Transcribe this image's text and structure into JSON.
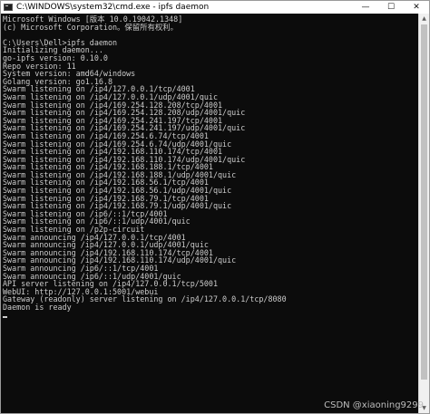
{
  "window": {
    "title": "C:\\WINDOWS\\system32\\cmd.exe - ipfs  daemon",
    "controls": {
      "minimize": "—",
      "maximize": "☐",
      "close": "✕"
    }
  },
  "console": {
    "lines": [
      "Microsoft Windows [版本 10.0.19042.1348]",
      "(c) Microsoft Corporation。保留所有权利。",
      "",
      "C:\\Users\\Dell>ipfs daemon",
      "Initializing daemon...",
      "go-ipfs version: 0.10.0",
      "Repo version: 11",
      "System version: amd64/windows",
      "Golang version: go1.16.8",
      "Swarm listening on /ip4/127.0.0.1/tcp/4001",
      "Swarm listening on /ip4/127.0.0.1/udp/4001/quic",
      "Swarm listening on /ip4/169.254.128.208/tcp/4001",
      "Swarm listening on /ip4/169.254.128.208/udp/4001/quic",
      "Swarm listening on /ip4/169.254.241.197/tcp/4001",
      "Swarm listening on /ip4/169.254.241.197/udp/4001/quic",
      "Swarm listening on /ip4/169.254.6.74/tcp/4001",
      "Swarm listening on /ip4/169.254.6.74/udp/4001/quic",
      "Swarm listening on /ip4/192.168.110.174/tcp/4001",
      "Swarm listening on /ip4/192.168.110.174/udp/4001/quic",
      "Swarm listening on /ip4/192.168.188.1/tcp/4001",
      "Swarm listening on /ip4/192.168.188.1/udp/4001/quic",
      "Swarm listening on /ip4/192.168.56.1/tcp/4001",
      "Swarm listening on /ip4/192.168.56.1/udp/4001/quic",
      "Swarm listening on /ip4/192.168.79.1/tcp/4001",
      "Swarm listening on /ip4/192.168.79.1/udp/4001/quic",
      "Swarm listening on /ip6/::1/tcp/4001",
      "Swarm listening on /ip6/::1/udp/4001/quic",
      "Swarm listening on /p2p-circuit",
      "Swarm announcing /ip4/127.0.0.1/tcp/4001",
      "Swarm announcing /ip4/127.0.0.1/udp/4001/quic",
      "Swarm announcing /ip4/192.168.110.174/tcp/4001",
      "Swarm announcing /ip4/192.168.110.174/udp/4001/quic",
      "Swarm announcing /ip6/::1/tcp/4001",
      "Swarm announcing /ip6/::1/udp/4001/quic",
      "API server listening on /ip4/127.0.0.1/tcp/5001",
      "WebUI: http://127.0.0.1:5001/webui",
      "Gateway (readonly) server listening on /ip4/127.0.0.1/tcp/8080",
      "Daemon is ready"
    ]
  },
  "watermark": "CSDN @xiaoning9299",
  "colors": {
    "console_background": "#0c0c0c",
    "console_text": "#cccccc",
    "titlebar_background": "#ffffff"
  }
}
